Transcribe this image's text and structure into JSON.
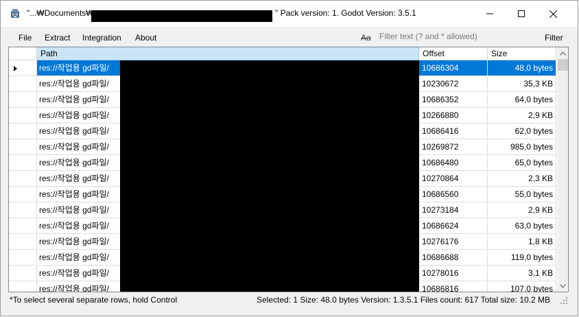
{
  "window": {
    "title_prefix": "\"...₩Documents₩",
    "title_suffix": "\" Pack version: 1. Godot Version: 3.5.1",
    "app_icon": "godot-re-icon"
  },
  "menu": {
    "items": [
      "File",
      "Extract",
      "Integration",
      "About"
    ],
    "match_case_label": "Aa",
    "filter_placeholder": "Filter text (? and * allowed)",
    "filter_value": "",
    "filter_button": "Filter"
  },
  "table": {
    "columns": [
      "Path",
      "Offset",
      "Size"
    ],
    "rows": [
      {
        "path": "res://작업용 gd파일/",
        "offset": "10686304",
        "size": "48,0 bytes"
      },
      {
        "path": "res://작업용 gd파일/",
        "offset": "10230672",
        "size": "35,3 KB"
      },
      {
        "path": "res://작업용 gd파일/",
        "offset": "10686352",
        "size": "64,0 bytes"
      },
      {
        "path": "res://작업용 gd파일/",
        "offset": "10266880",
        "size": "2,9 KB"
      },
      {
        "path": "res://작업용 gd파일/",
        "offset": "10686416",
        "size": "62,0 bytes"
      },
      {
        "path": "res://작업용 gd파일/",
        "offset": "10269872",
        "size": "985,0 bytes"
      },
      {
        "path": "res://작업용 gd파일/",
        "offset": "10686480",
        "size": "65,0 bytes"
      },
      {
        "path": "res://작업용 gd파일/",
        "offset": "10270864",
        "size": "2,3 KB"
      },
      {
        "path": "res://작업용 gd파일/",
        "offset": "10686560",
        "size": "55,0 bytes"
      },
      {
        "path": "res://작업용 gd파일/",
        "offset": "10273184",
        "size": "2,9 KB"
      },
      {
        "path": "res://작업용 gd파일/",
        "offset": "10686624",
        "size": "63,0 bytes"
      },
      {
        "path": "res://작업용 gd파일/",
        "offset": "10276176",
        "size": "1,8 KB"
      },
      {
        "path": "res://작업용 gd파일/",
        "offset": "10686688",
        "size": "119,0 bytes"
      },
      {
        "path": "res://작업용 gd파일/",
        "offset": "10278016",
        "size": "3,1 KB"
      },
      {
        "path": "res://작업용 gd파일/",
        "offset": "10686816",
        "size": "107,0 bytes"
      }
    ],
    "selected_row": 0
  },
  "status": {
    "hint": "*To select several separate rows, hold Control",
    "info": "Selected: 1 Size: 48.0 bytes  Version: 1.3.5.1 Files count: 617 Total size: 10.2 MB"
  },
  "colors": {
    "selection": "#0078d7",
    "header_active": "#cce4f7"
  }
}
